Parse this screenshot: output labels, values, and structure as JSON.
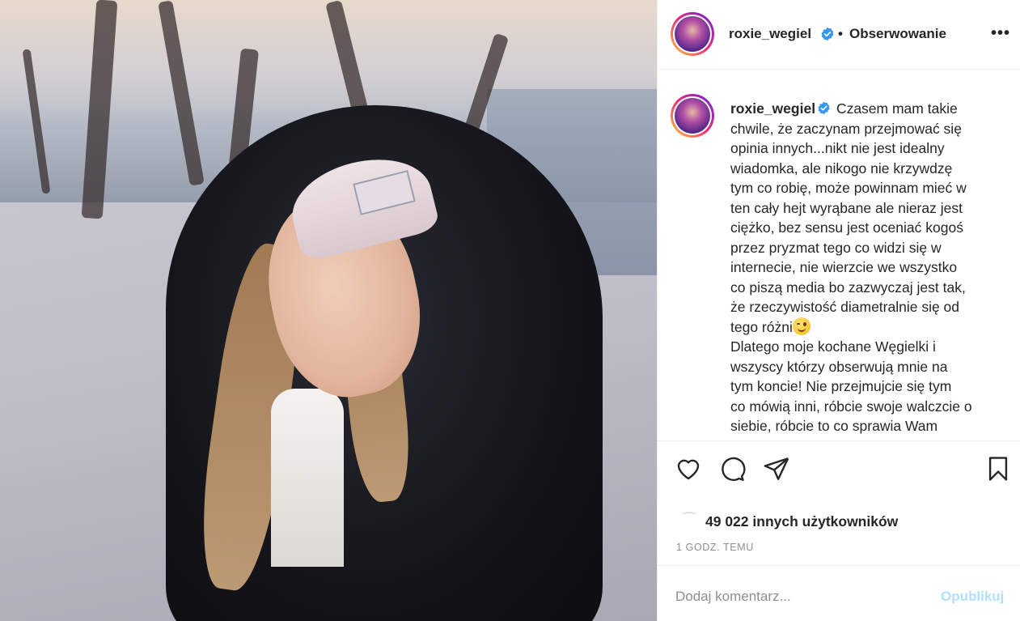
{
  "post": {
    "image_alt": "Zdjęcie posta"
  },
  "header": {
    "username": "roxie_wegiel",
    "dot": "•",
    "follow_label": "Obserwowanie",
    "more_label": "•••"
  },
  "caption": {
    "username": "roxie_wegiel",
    "lines": [
      "Czasem mam takie",
      "chwile, że zaczynam przejmować się",
      "opinia innych...nikt nie jest idealny",
      "wiadomka, ale nikogo nie krzywdzę",
      "tym co robię, może powinnam mieć w",
      "ten cały hejt wyrąbane ale nieraz jest",
      "ciężko, bez sensu jest oceniać kogoś",
      "przez pryzmat tego co widzi się w",
      "internecie, nie wierzcie we wszystko",
      "co piszą media bo zazwyczaj jest tak,",
      "że rzeczywistość diametralnie się od",
      "tego różni",
      "Dlatego moje kochane Węgielki i",
      "wszyscy którzy obserwują mnie na",
      "tym koncie! Nie przejmujcie się tym",
      "co mówią inni, róbcie swoje walczcie o",
      "siebie, róbcie to co sprawia Wam"
    ]
  },
  "actions": {
    "like_icon": "heart-icon",
    "comment_icon": "comment-icon",
    "share_icon": "paper-plane-icon",
    "save_icon": "bookmark-icon"
  },
  "likes": {
    "text": "49 022 innych użytkowników"
  },
  "time": {
    "text": "1 GODZ. TEMU"
  },
  "comment": {
    "placeholder": "Dodaj komentarz...",
    "publish_label": "Opublikuj"
  },
  "colors": {
    "verified": "#3897f0",
    "publish_disabled": "#b2dffc",
    "muted": "#8e8e8e",
    "text": "#262626"
  }
}
